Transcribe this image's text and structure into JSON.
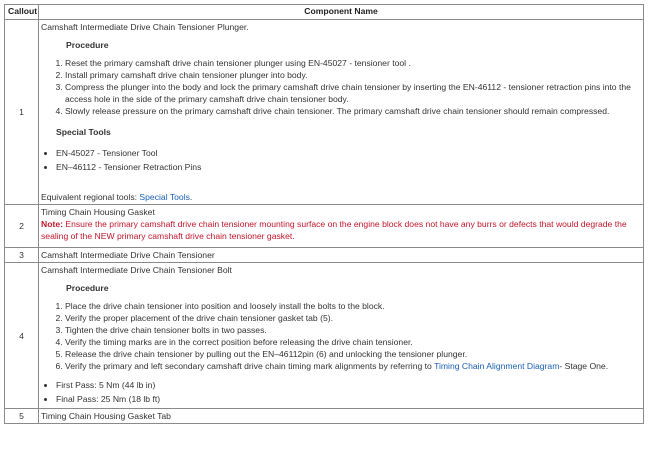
{
  "headers": {
    "callout": "Callout",
    "component": "Component Name"
  },
  "rows": [
    {
      "callout": "1",
      "component": "Camshaft Intermediate Drive Chain Tensioner Plunger.",
      "procedure_label": "Procedure",
      "steps": [
        "Reset the primary camshaft drive chain tensioner plunger using EN-45027 - tensioner tool .",
        "Install primary camshaft drive chain tensioner plunger into body.",
        "Compress the plunger into the body and lock the primary camshaft drive chain tensioner by inserting the EN-46112 - tensioner retraction pins into the access hole in the side of the primary camshaft drive chain tensioner body.",
        "Slowly release pressure on the primary camshaft drive chain tensioner. The primary camshaft drive chain tensioner should remain compressed."
      ],
      "special_tools_label": "Special Tools",
      "special_tools": [
        "EN-45027 - Tensioner Tool",
        "EN–46112 - Tensioner Retraction Pins"
      ],
      "equiv_text": "Equivalent regional tools: ",
      "equiv_link": "Special Tools",
      "equiv_end": "."
    },
    {
      "callout": "2",
      "component": "Timing Chain Housing Gasket",
      "note_label": "Note:",
      "note_text": " Ensure the primary camshaft drive chain tensioner mounting surface on the engine block does not have any burrs or defects that would degrade the sealing of the NEW primary camshaft drive chain tensioner gasket."
    },
    {
      "callout": "3",
      "component": "Camshaft Intermediate Drive Chain Tensioner"
    },
    {
      "callout": "4",
      "component": "Camshaft Intermediate Drive Chain Tensioner Bolt",
      "procedure_label": "Procedure",
      "steps": [
        "Place the drive chain tensioner into position and loosely install the bolts to the block.",
        "Verify the proper placement of the drive chain tensioner gasket tab (5).",
        "Tighten the drive chain tensioner bolts in two passes.",
        "Verify the timing marks are in the correct position before releasing the drive chain tensioner.",
        "Release the drive chain tensioner by pulling out the EN–46112pin (6) and unlocking the tensioner plunger."
      ],
      "step6_text": "Verify the primary and left secondary camshaft drive chain timing mark alignments by referring to ",
      "step6_link": "Timing Chain Alignment Diagram",
      "step6_end": "- Stage One.",
      "passes": [
        "First Pass: 5 Nm (44 lb in)",
        "Final Pass: 25 Nm (18 lb ft)"
      ]
    },
    {
      "callout": "5",
      "component": "Timing Chain Housing Gasket Tab"
    }
  ]
}
